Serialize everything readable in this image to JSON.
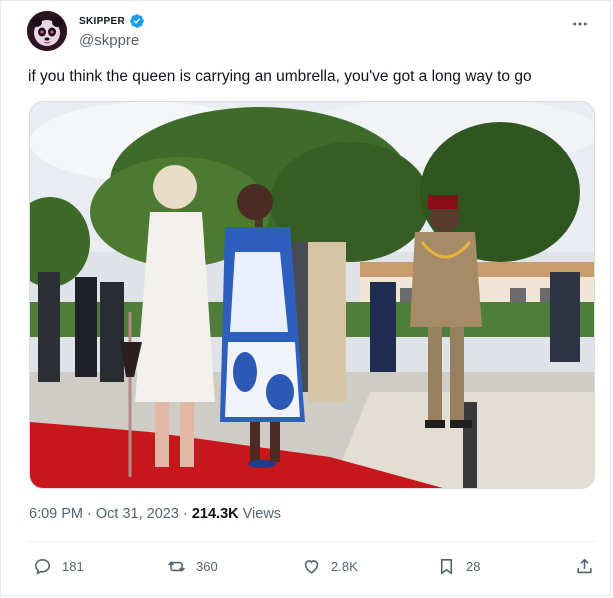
{
  "author": {
    "display_name": "SKIPPER",
    "handle": "@skppre",
    "verified": true,
    "avatar_icon": "panda-avatar-icon"
  },
  "tweet": {
    "text": "if you think the queen is carrying an umbrella, you've got a long way to go"
  },
  "meta": {
    "time": "6:09 PM",
    "separator": "·",
    "date": "Oct 31, 2023",
    "separator2": "·",
    "views_count": "214.3K",
    "views_label": "Views"
  },
  "actions": {
    "replies": "181",
    "retweets": "360",
    "likes": "2.8K",
    "bookmarks": "28"
  },
  "colors": {
    "verified_blue": "#1d9bf0",
    "secondary_text": "#536471",
    "carpet_red": "#c8161d"
  }
}
